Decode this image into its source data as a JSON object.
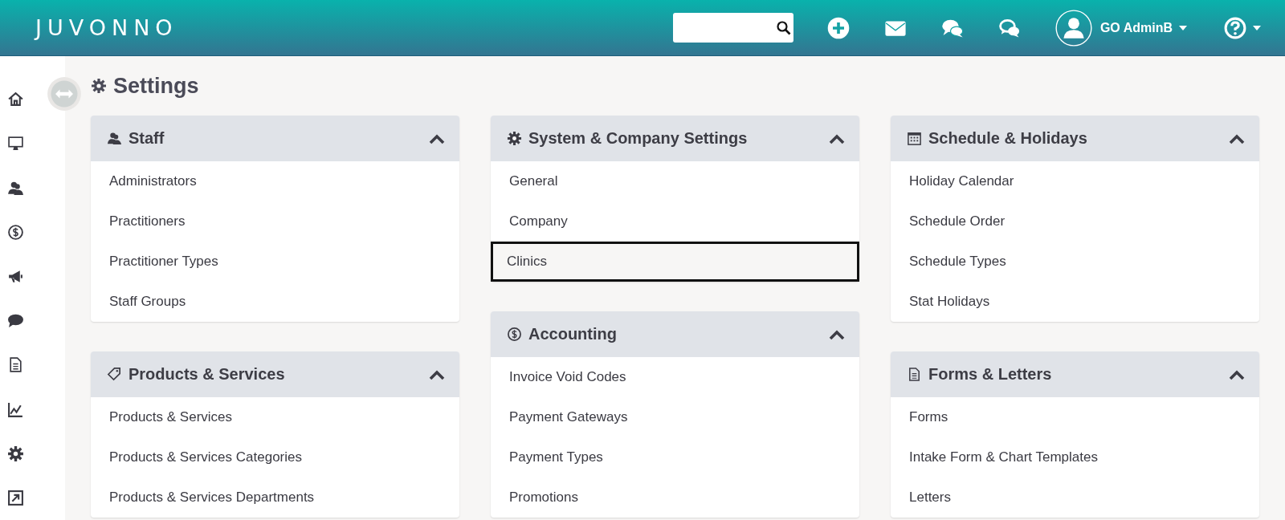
{
  "brand": {
    "logo": "JUVONNO"
  },
  "topbar": {
    "actions": [
      {
        "kind": "plus"
      },
      {
        "kind": "mail"
      },
      {
        "kind": "chat"
      },
      {
        "kind": "chat-alt"
      }
    ],
    "user": {
      "name": "GO AdminB"
    }
  },
  "sidebar": {
    "items": [
      {
        "kind": "home"
      },
      {
        "kind": "monitor"
      },
      {
        "kind": "staff"
      },
      {
        "kind": "dollar"
      },
      {
        "kind": "megaphone"
      },
      {
        "kind": "chat"
      },
      {
        "kind": "document"
      },
      {
        "kind": "chart"
      },
      {
        "kind": "gear"
      },
      {
        "kind": "external"
      }
    ]
  },
  "page": {
    "title": "Settings"
  },
  "columns": [
    [
      {
        "title": "Staff",
        "kind": "staff",
        "expanded": true,
        "items": [
          {
            "label": "Administrators",
            "focused": false
          },
          {
            "label": "Practitioners",
            "focused": false
          },
          {
            "label": "Practitioner Types",
            "focused": false
          },
          {
            "label": "Staff Groups",
            "focused": false
          }
        ]
      },
      {
        "title": "Products & Services",
        "kind": "tag",
        "expanded": true,
        "items": [
          {
            "label": "Products & Services",
            "focused": false
          },
          {
            "label": "Products & Services Categories",
            "focused": false
          },
          {
            "label": "Products & Services Departments",
            "focused": false
          }
        ]
      }
    ],
    [
      {
        "title": "System & Company Settings",
        "kind": "gear",
        "expanded": true,
        "items": [
          {
            "label": "General",
            "focused": false
          },
          {
            "label": "Company",
            "focused": false
          },
          {
            "label": "Clinics",
            "focused": true
          }
        ]
      },
      {
        "title": "Accounting",
        "kind": "dollar",
        "expanded": true,
        "items": [
          {
            "label": "Invoice Void Codes",
            "focused": false
          },
          {
            "label": "Payment Gateways",
            "focused": false
          },
          {
            "label": "Payment Types",
            "focused": false
          },
          {
            "label": "Promotions",
            "focused": false
          }
        ]
      }
    ],
    [
      {
        "title": "Schedule & Holidays",
        "kind": "calendar",
        "expanded": true,
        "items": [
          {
            "label": "Holiday Calendar",
            "focused": false
          },
          {
            "label": "Schedule Order",
            "focused": false
          },
          {
            "label": "Schedule Types",
            "focused": false
          },
          {
            "label": "Stat Holidays",
            "focused": false
          }
        ]
      },
      {
        "title": "Forms & Letters",
        "kind": "document",
        "expanded": true,
        "items": [
          {
            "label": "Forms",
            "focused": false
          },
          {
            "label": "Intake Form & Chart Templates",
            "focused": false
          },
          {
            "label": "Letters",
            "focused": false
          }
        ]
      }
    ]
  ]
}
